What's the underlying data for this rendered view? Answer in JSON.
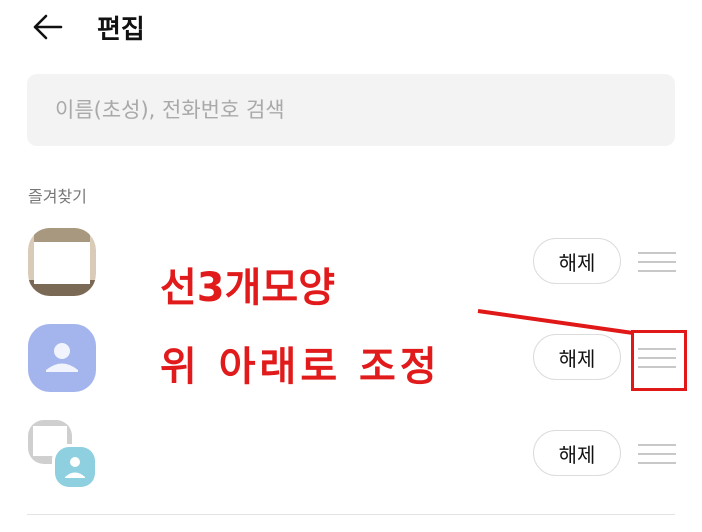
{
  "header": {
    "title": "편집",
    "back_icon": "arrow-left-icon"
  },
  "search": {
    "placeholder": "이름(초성), 전화번호 검색",
    "value": ""
  },
  "favorites": {
    "section_label": "즐겨찾기",
    "items": [
      {
        "avatar": "photo-avatar",
        "unlink_label": "해제"
      },
      {
        "avatar": "default-person-avatar",
        "unlink_label": "해제"
      },
      {
        "avatar": "group-avatar",
        "unlink_label": "해제"
      }
    ]
  },
  "annotation": {
    "line1": "선3개모양",
    "line2": "위 아래로 조정",
    "color": "#e11b1b"
  },
  "colors": {
    "default_avatar": "#a4b4ec",
    "group_avatar_badge": "#8ecfe0",
    "search_bg": "#f3f3f3"
  }
}
